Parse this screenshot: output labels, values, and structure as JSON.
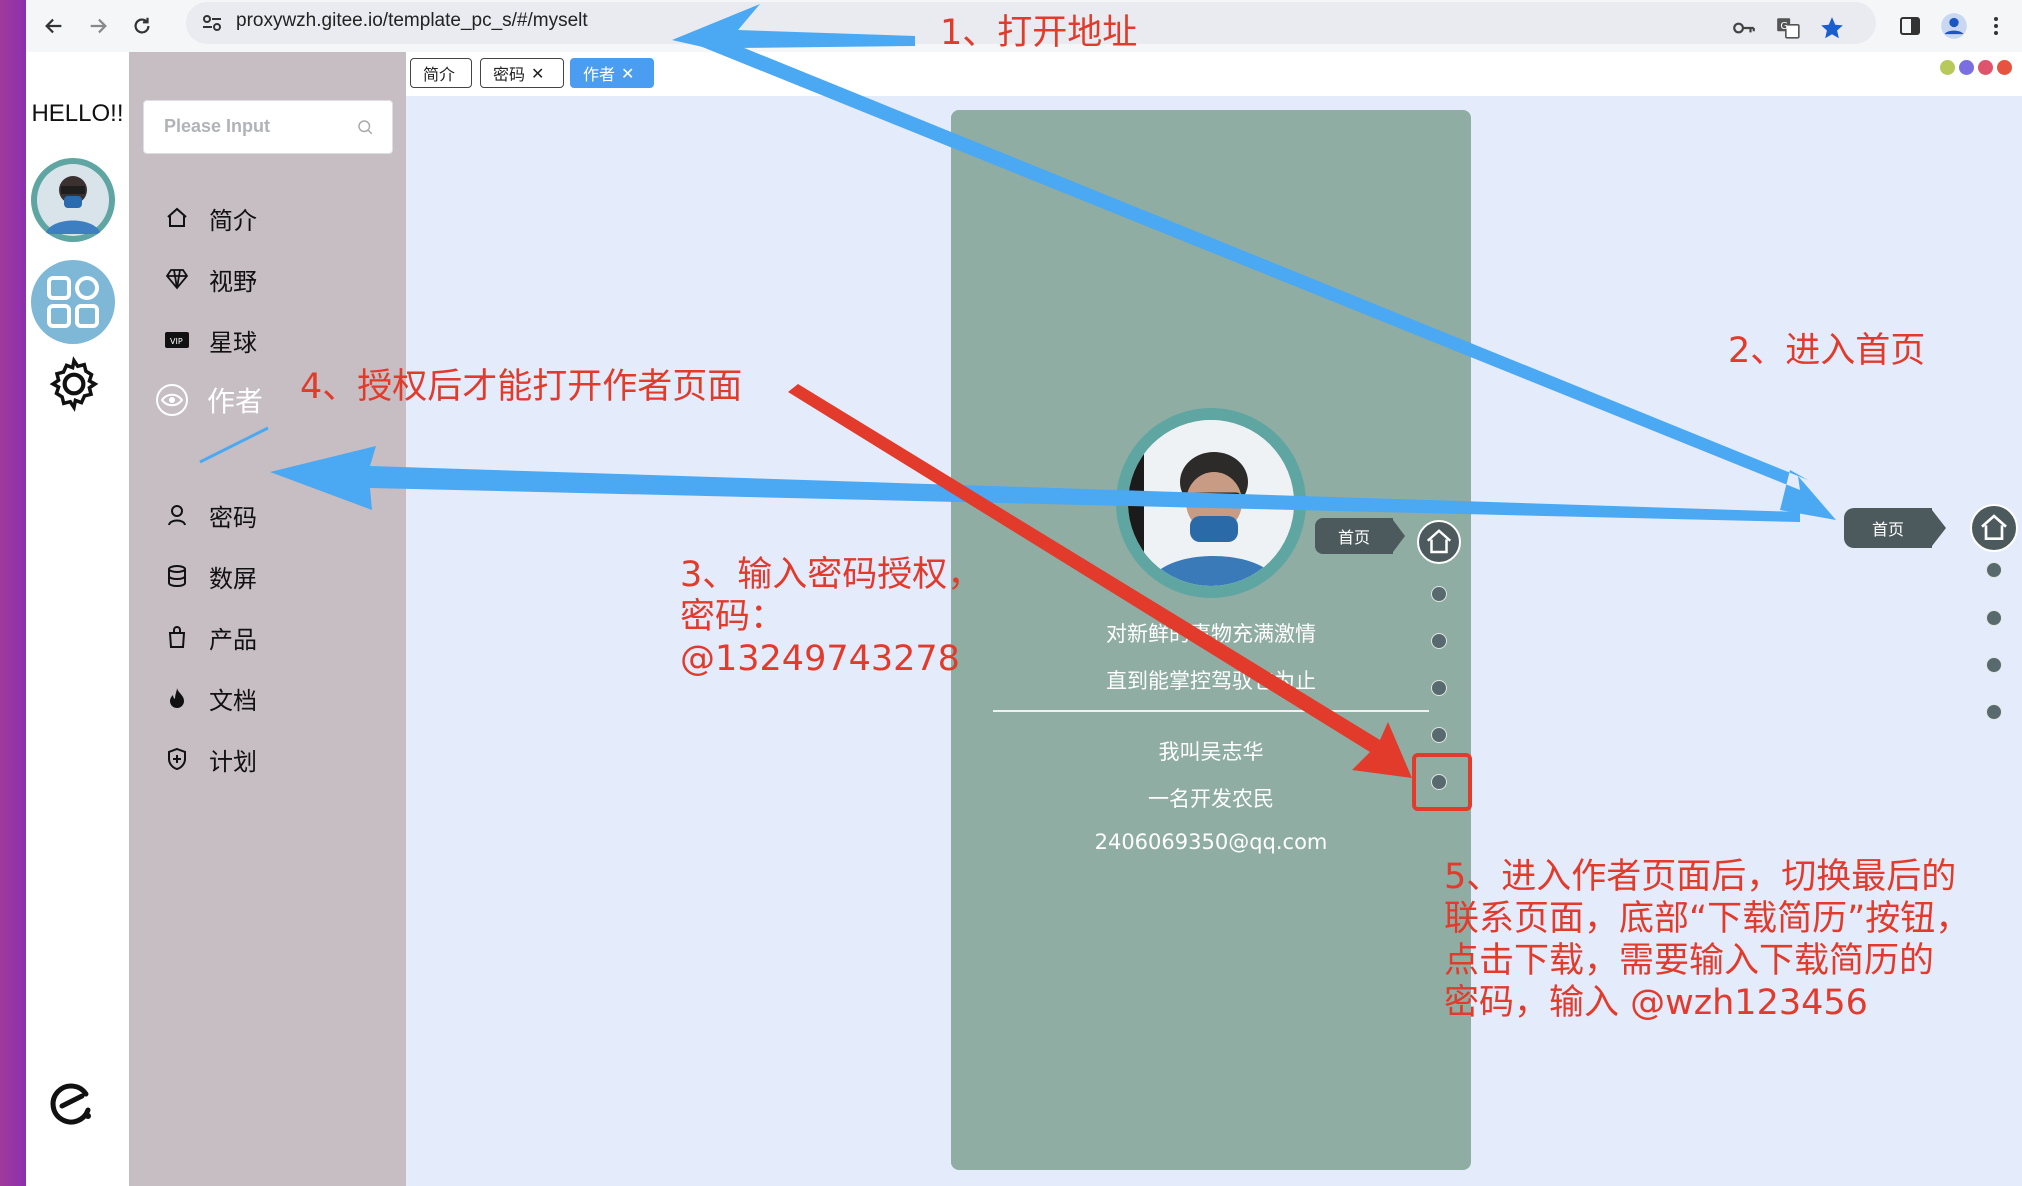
{
  "browser": {
    "url": "proxywzh.gitee.io/template_pc_s/#/myselt",
    "back_icon": "arrow-left",
    "forward_icon": "arrow-right",
    "reload_icon": "reload",
    "site_info_icon": "tune"
  },
  "rail": {
    "greeting": "HELLO!!"
  },
  "sidebar": {
    "search_placeholder": "Please Input",
    "items": [
      {
        "label": "简介",
        "icon": "home-icon"
      },
      {
        "label": "视野",
        "icon": "diamond-icon"
      },
      {
        "label": "星球",
        "icon": "vip-card-icon"
      },
      {
        "label": "作者",
        "icon": "eye-icon",
        "active": true
      },
      {
        "label": "密码",
        "icon": "user-icon"
      },
      {
        "label": "数屏",
        "icon": "database-icon"
      },
      {
        "label": "产品",
        "icon": "bag-icon"
      },
      {
        "label": "文档",
        "icon": "flame-icon"
      },
      {
        "label": "计划",
        "icon": "shield-plus-icon"
      }
    ]
  },
  "tabs": [
    {
      "label": "简介",
      "closable": false
    },
    {
      "label": "密码",
      "closable": true
    },
    {
      "label": "作者",
      "closable": true,
      "active": true
    }
  ],
  "profile": {
    "motto_line1": "对新鲜的事物充满激情",
    "motto_line2": "直到能掌控驾驭它为止",
    "name": "我叫吴志华",
    "title": "一名开发农民",
    "email": "2406069350@qq.com",
    "home_label": "首页"
  },
  "home_float": {
    "label": "首页"
  },
  "annotations": {
    "step1": "1、打开地址",
    "step2": "2、进入首页",
    "step3_line1": "3、输入密码授权，",
    "step3_line2": "密码：",
    "step3_line3": "@13249743278",
    "step4": "4、授权后才能打开作者页面",
    "step5_line1": "5、进入作者页面后，切换最后的",
    "step5_line2": "联系页面，底部“下载简历”按钮，",
    "step5_line3": "点击下载，需要输入下载简历的",
    "step5_line4": "密码，输入 @wzh123456"
  },
  "colors": {
    "accent_tab": "#4a9df0",
    "card": "#8fada3",
    "annotation_red": "#e23a2b",
    "arrow_blue": "#4ba8f2"
  }
}
